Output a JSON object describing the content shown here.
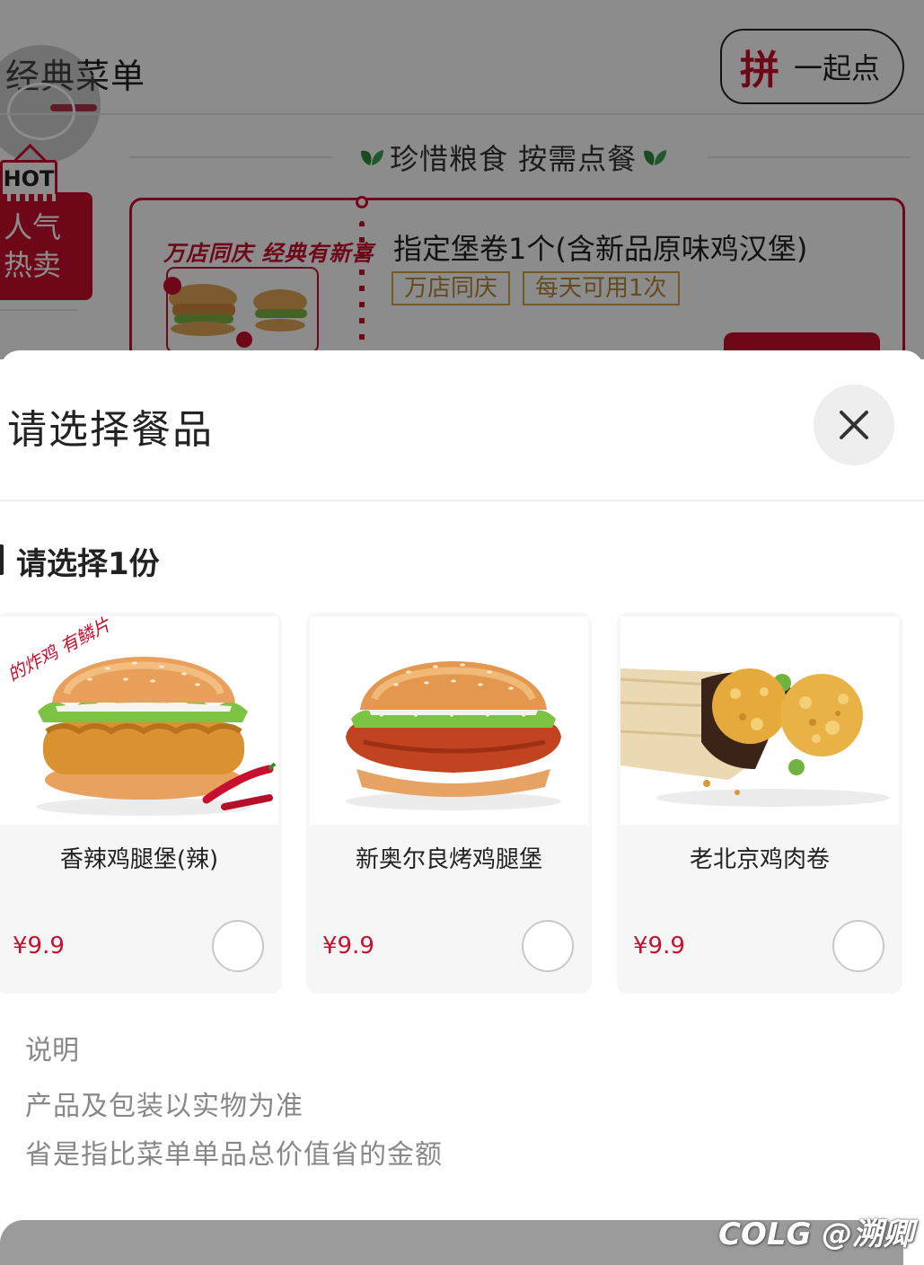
{
  "background": {
    "header_title": "经典菜单",
    "group_button": {
      "icon_char": "拼",
      "label": "一起点"
    },
    "slogan": "珍惜粮食 按需点餐",
    "hot_tag": "HOT",
    "side_category": {
      "line1": "人气",
      "line2": "热卖"
    },
    "promo": {
      "image_title": "万店同庆 经典有新喜",
      "title": "指定堡卷1个(含新品原味鸡汉堡)",
      "tags": [
        "万店同庆",
        "每天可用1次"
      ]
    }
  },
  "sheet": {
    "title": "请选择餐品",
    "section_title": "请选择1份",
    "items": [
      {
        "name": "香辣鸡腿堡(辣)",
        "price": "¥9.9",
        "badge_text": "的炸鸡 有鳞片"
      },
      {
        "name": "新奥尔良烤鸡腿堡",
        "price": "¥9.9"
      },
      {
        "name": "老北京鸡肉卷",
        "price": "¥9.9"
      }
    ],
    "note": {
      "title": "说明",
      "lines": [
        "产品及包装以实物为准",
        "省是指比菜单单品总价值省的金额"
      ]
    }
  },
  "watermark": "COLG @溯卿",
  "colors": {
    "brand_red": "#c8102e",
    "tag_gold": "#b7873a",
    "muted_text": "#888888"
  }
}
